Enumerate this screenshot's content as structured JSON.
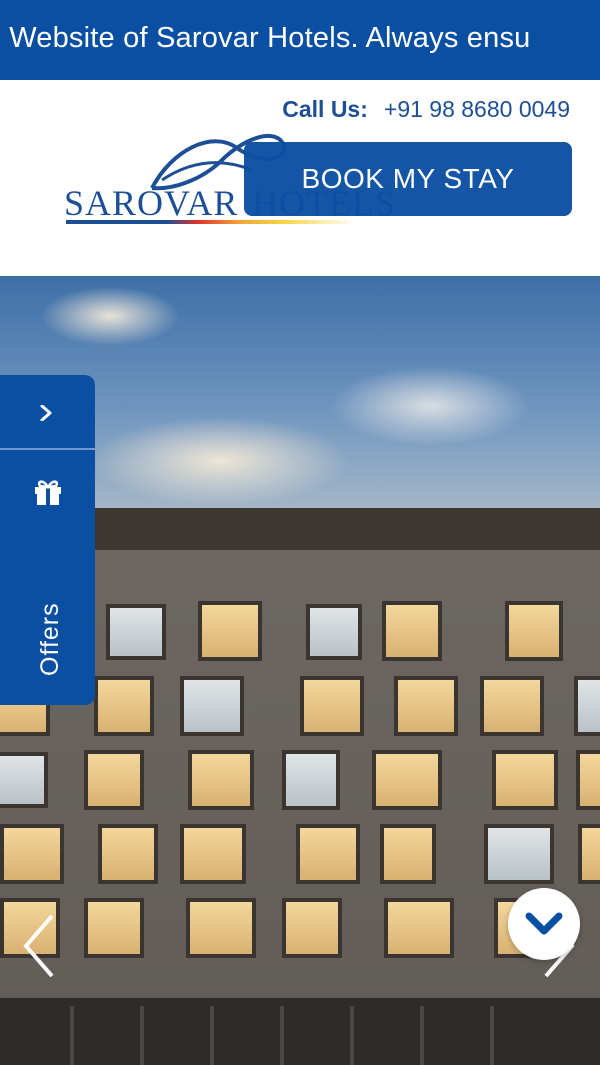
{
  "ticker": {
    "text": "al Website of Sarovar Hotels. Always ensu"
  },
  "header": {
    "call_label": "Call Us:",
    "phone": "+91 98 8680 0049",
    "logo_text_left": "SAROVAR",
    "logo_text_right": "HOTELS",
    "book_button": "BOOK MY STAY"
  },
  "side_panel": {
    "expand_icon": "chevron-right-icon",
    "gift_icon": "gift-icon",
    "label": "Offers"
  },
  "carousel": {
    "prev_icon": "chevron-left-icon",
    "next_icon": "chevron-right-icon",
    "scroll_down_icon": "chevron-down-icon"
  },
  "colors": {
    "primary": "#0b4fa3",
    "header_text": "#1c4f95",
    "white": "#ffffff"
  }
}
